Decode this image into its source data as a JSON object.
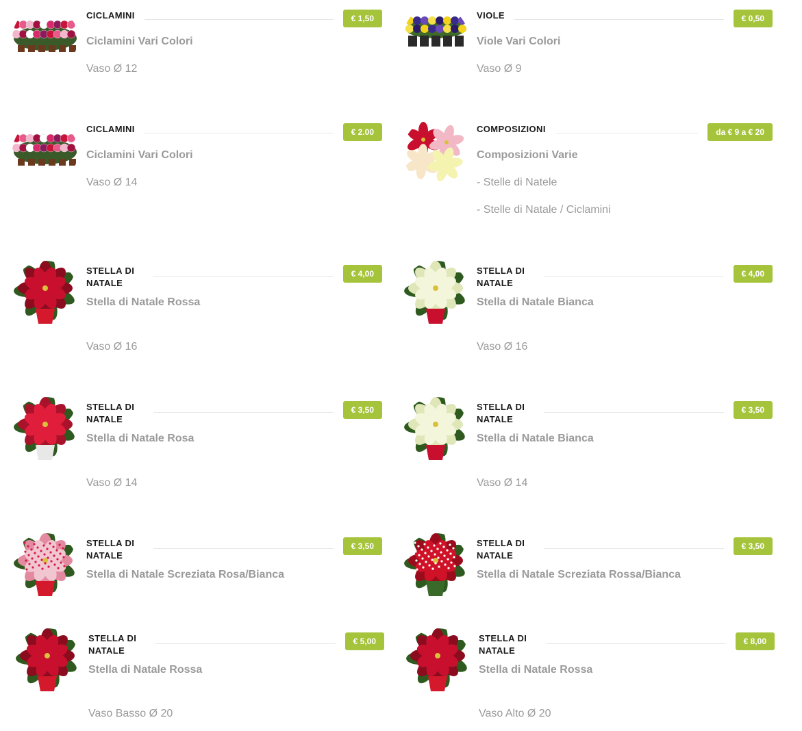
{
  "products": [
    {
      "category": "CICLAMINI",
      "price": "€ 1,50",
      "name": "Ciclamini Vari Colori",
      "details": [
        "Vaso Ø 12"
      ],
      "image": "cyclamen-image"
    },
    {
      "category": "VIOLE",
      "price": "€ 0,50",
      "name": "Viole Vari Colori",
      "details": [
        "Vaso Ø 9"
      ],
      "image": "violets-image"
    },
    {
      "category": "CICLAMINI",
      "price": "€ 2.00",
      "name": "Ciclamini Vari Colori",
      "details": [
        "Vaso Ø 14"
      ],
      "image": "cyclamen-image"
    },
    {
      "category": "COMPOSIZIONI",
      "price": "da € 9 a € 20",
      "name": "Composizioni Varie",
      "details": [
        "- Stelle di Natele",
        "- Stelle di Natale / Ciclamini"
      ],
      "image": "composition-image"
    },
    {
      "category": "STELLA DI NATALE",
      "price": "€ 4,00",
      "name": "Stella di Natale Rossa",
      "details": [
        "Vaso Ø 16"
      ],
      "image": "red-poinsettia-image"
    },
    {
      "category": "STELLA DI NATALE",
      "price": "€ 4,00",
      "name": "Stella di Natale Bianca",
      "details": [
        "Vaso Ø 16"
      ],
      "image": "white-poinsettia-image"
    },
    {
      "category": "STELLA DI NATALE",
      "price": "€ 3,50",
      "name": "Stella di Natale Rosa",
      "details": [
        "Vaso Ø 14"
      ],
      "image": "pink-poinsettia-image"
    },
    {
      "category": "STELLA DI NATALE",
      "price": "€ 3,50",
      "name": "Stella di Natale Bianca",
      "details": [
        "Vaso Ø 14"
      ],
      "image": "white-poinsettia-image"
    },
    {
      "category": "STELLA DI NATALE",
      "price": "€ 3,50",
      "name": "Stella di Natale Screziata Rosa/Bianca",
      "details": [],
      "image": "variegated-pink-poinsettia-image"
    },
    {
      "category": "STELLA DI NATALE",
      "price": "€ 3,50",
      "name": "Stella di Natale Screziata Rossa/Bianca",
      "details": [],
      "image": "variegated-red-poinsettia-image"
    },
    {
      "category": "STELLA DI NATALE",
      "price": "€ 5,00",
      "name": "Stella di Natale Rossa",
      "details": [
        "Vaso Basso Ø 20"
      ],
      "image": "red-poinsettia-image"
    },
    {
      "category": "STELLA DI NATALE",
      "price": "€ 8,00",
      "name": "Stella di Natale Rossa",
      "details": [
        "Vaso Alto Ø 20"
      ],
      "image": "red-poinsettia-image"
    }
  ],
  "colors": {
    "price_badge": "#a5c43b",
    "category_text": "#1a1a1a",
    "muted_text": "#9a9a9a",
    "rule": "#e6e6e6"
  }
}
